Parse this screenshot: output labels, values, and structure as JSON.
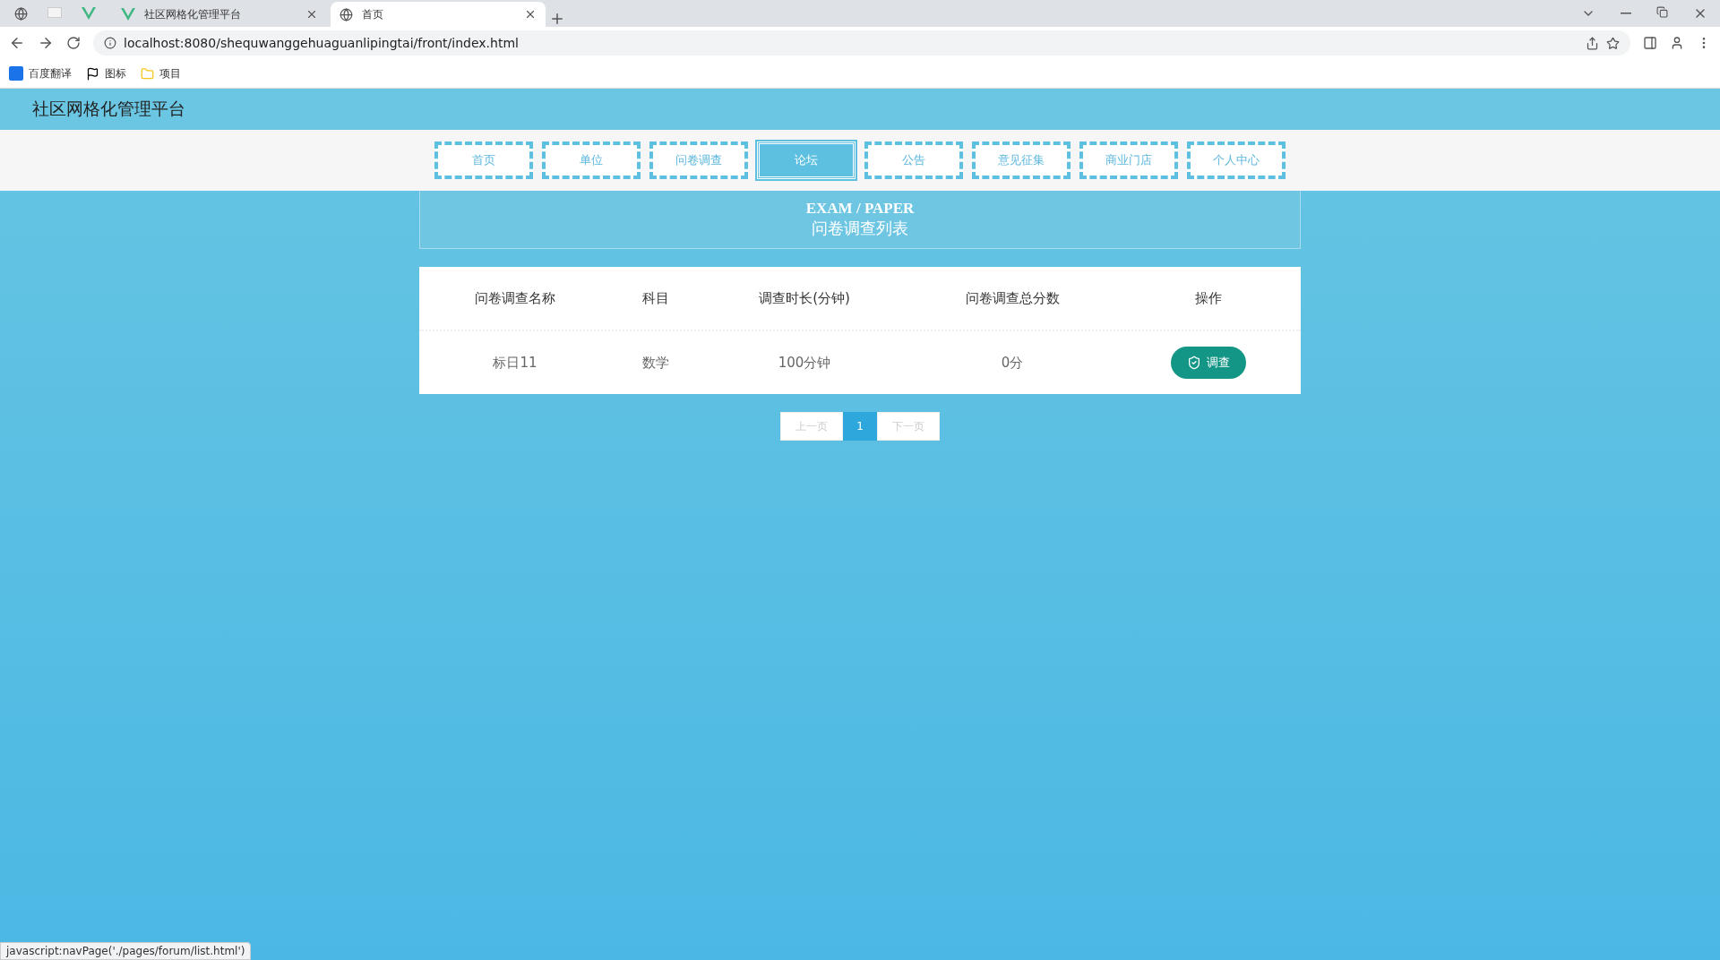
{
  "browser": {
    "tabs": [
      {
        "title": "社区网格化管理平台",
        "selected": false,
        "kind": "vue"
      },
      {
        "title": "首页",
        "selected": true,
        "kind": "globe"
      }
    ],
    "url": "localhost:8080/shequwanggehuaguanlipingtai/front/index.html",
    "bookmarks": [
      {
        "label": "百度翻译",
        "kind": "translate"
      },
      {
        "label": "图标",
        "kind": "flag"
      },
      {
        "label": "项目",
        "kind": "folder"
      }
    ],
    "status_url": "javascript:navPage('./pages/forum/list.html')"
  },
  "site_title": "社区网格化管理平台",
  "nav": [
    {
      "label": "首页",
      "selected": false
    },
    {
      "label": "单位",
      "selected": false
    },
    {
      "label": "问卷调查",
      "selected": false
    },
    {
      "label": "论坛",
      "selected": true
    },
    {
      "label": "公告",
      "selected": false
    },
    {
      "label": "意见征集",
      "selected": false
    },
    {
      "label": "商业门店",
      "selected": false
    },
    {
      "label": "个人中心",
      "selected": false
    }
  ],
  "section": {
    "title_en": "EXAM / PAPER",
    "title": "问卷调查列表"
  },
  "table": {
    "columns": [
      "问卷调查名称",
      "科目",
      "调查时长(分钟)",
      "问卷调查总分数",
      "操作"
    ],
    "rows": [
      {
        "cells": [
          "标日11",
          "数学",
          "100分钟",
          "0分"
        ],
        "action": "调查"
      }
    ]
  },
  "pagination": {
    "prev": "上一页",
    "pages": [
      {
        "label": "1",
        "selected": true
      }
    ],
    "next": "下一页"
  }
}
